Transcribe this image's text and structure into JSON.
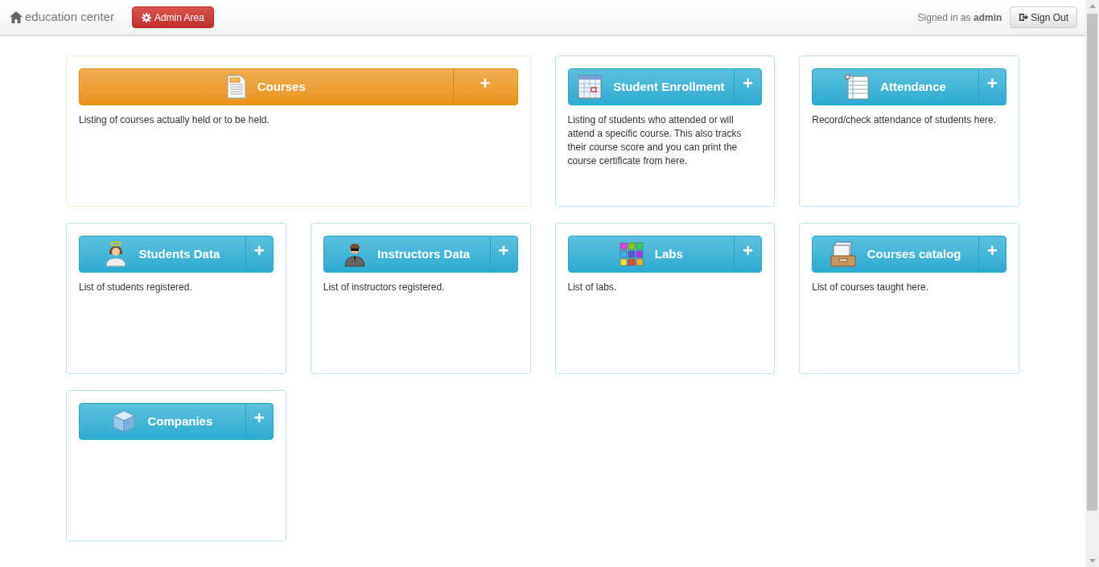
{
  "navbar": {
    "brand": "education center",
    "admin_button": "Admin Area",
    "signed_in_prefix": "Signed in as",
    "user": "admin",
    "sign_out": "Sign Out"
  },
  "cards": [
    {
      "title": "Courses",
      "kind": "warning",
      "wide": true,
      "add": "+",
      "description": "Listing of courses actually held or to be held."
    },
    {
      "title": "Student Enrollment",
      "kind": "info",
      "wide": false,
      "add": "+",
      "description": "Listing of students who attended or will attend a specific course. This also tracks their course score and you can print the course certificate from here."
    },
    {
      "title": "Attendance",
      "kind": "info",
      "wide": false,
      "add": "+",
      "description": "Record/check attendance of students here."
    },
    {
      "title": "Students Data",
      "kind": "info",
      "wide": false,
      "add": "+",
      "description": "List of students registered."
    },
    {
      "title": "Instructors Data",
      "kind": "info",
      "wide": false,
      "add": "+",
      "description": "List of instructors registered."
    },
    {
      "title": "Labs",
      "kind": "info",
      "wide": false,
      "add": "+",
      "description": "List of labs."
    },
    {
      "title": "Courses catalog",
      "kind": "info",
      "wide": false,
      "add": "+",
      "description": "List of courses taught here."
    },
    {
      "title": "Companies",
      "kind": "info",
      "wide": false,
      "add": "+"
    }
  ]
}
